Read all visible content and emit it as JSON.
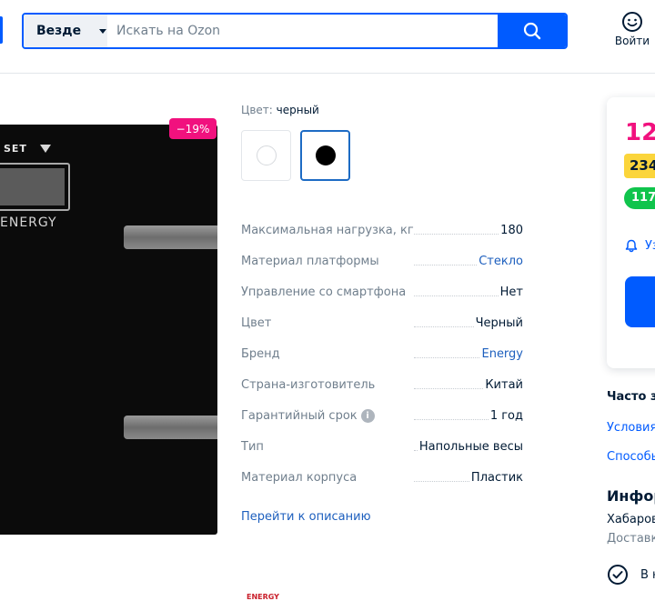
{
  "header": {
    "search_scope": "Везде",
    "search_placeholder": "Искать на Ozon",
    "login_label": "Войти"
  },
  "product_image": {
    "discount_badge": "−19%",
    "printed_button_label": "SET",
    "printed_brand": "ENERGY",
    "bottom_thumbnail_brand": "ENERGY"
  },
  "color": {
    "label": "Цвет:",
    "value": "черный",
    "swatches": [
      {
        "name": "белый",
        "color": "#ffffff",
        "selected": false
      },
      {
        "name": "черный",
        "color": "#000000",
        "selected": true
      }
    ]
  },
  "specs": [
    {
      "name": "Максимальная нагрузка, кг",
      "value": "180",
      "link": false
    },
    {
      "name": "Материал платформы",
      "value": "Стекло",
      "link": true
    },
    {
      "name": "Управление со смартфона",
      "value": "Нет",
      "link": false
    },
    {
      "name": "Цвет",
      "value": "Черный",
      "link": false
    },
    {
      "name": "Бренд",
      "value": "Energy",
      "link": true
    },
    {
      "name": "Страна-изготовитель",
      "value": "Китай",
      "link": false
    },
    {
      "name": "Гарантийный срок",
      "value": "1 год",
      "link": false,
      "info_icon": true
    },
    {
      "name": "Тип",
      "value": "Напольные весы",
      "link": false
    },
    {
      "name": "Материал корпуса",
      "value": "Пластик",
      "link": false
    }
  ],
  "description_link": "Перейти к описанию",
  "price_card": {
    "price": "12",
    "yellow_pill": "234",
    "green_pill": "117",
    "notify_text": "Уз"
  },
  "right_column": {
    "often_title": "Часто з",
    "link_1": "Условия",
    "link_2": "Способы",
    "info_title": "Инфор",
    "info_city": "Хабаров",
    "info_delivery": "Доставка",
    "check_text": "В н"
  },
  "colors": {
    "accent": "#005bff",
    "discount": "#f1117e",
    "price": "#f1117e",
    "yellow_badge": "#fbd53b",
    "green_badge": "#10c44c",
    "link": "#1d5fbe"
  }
}
